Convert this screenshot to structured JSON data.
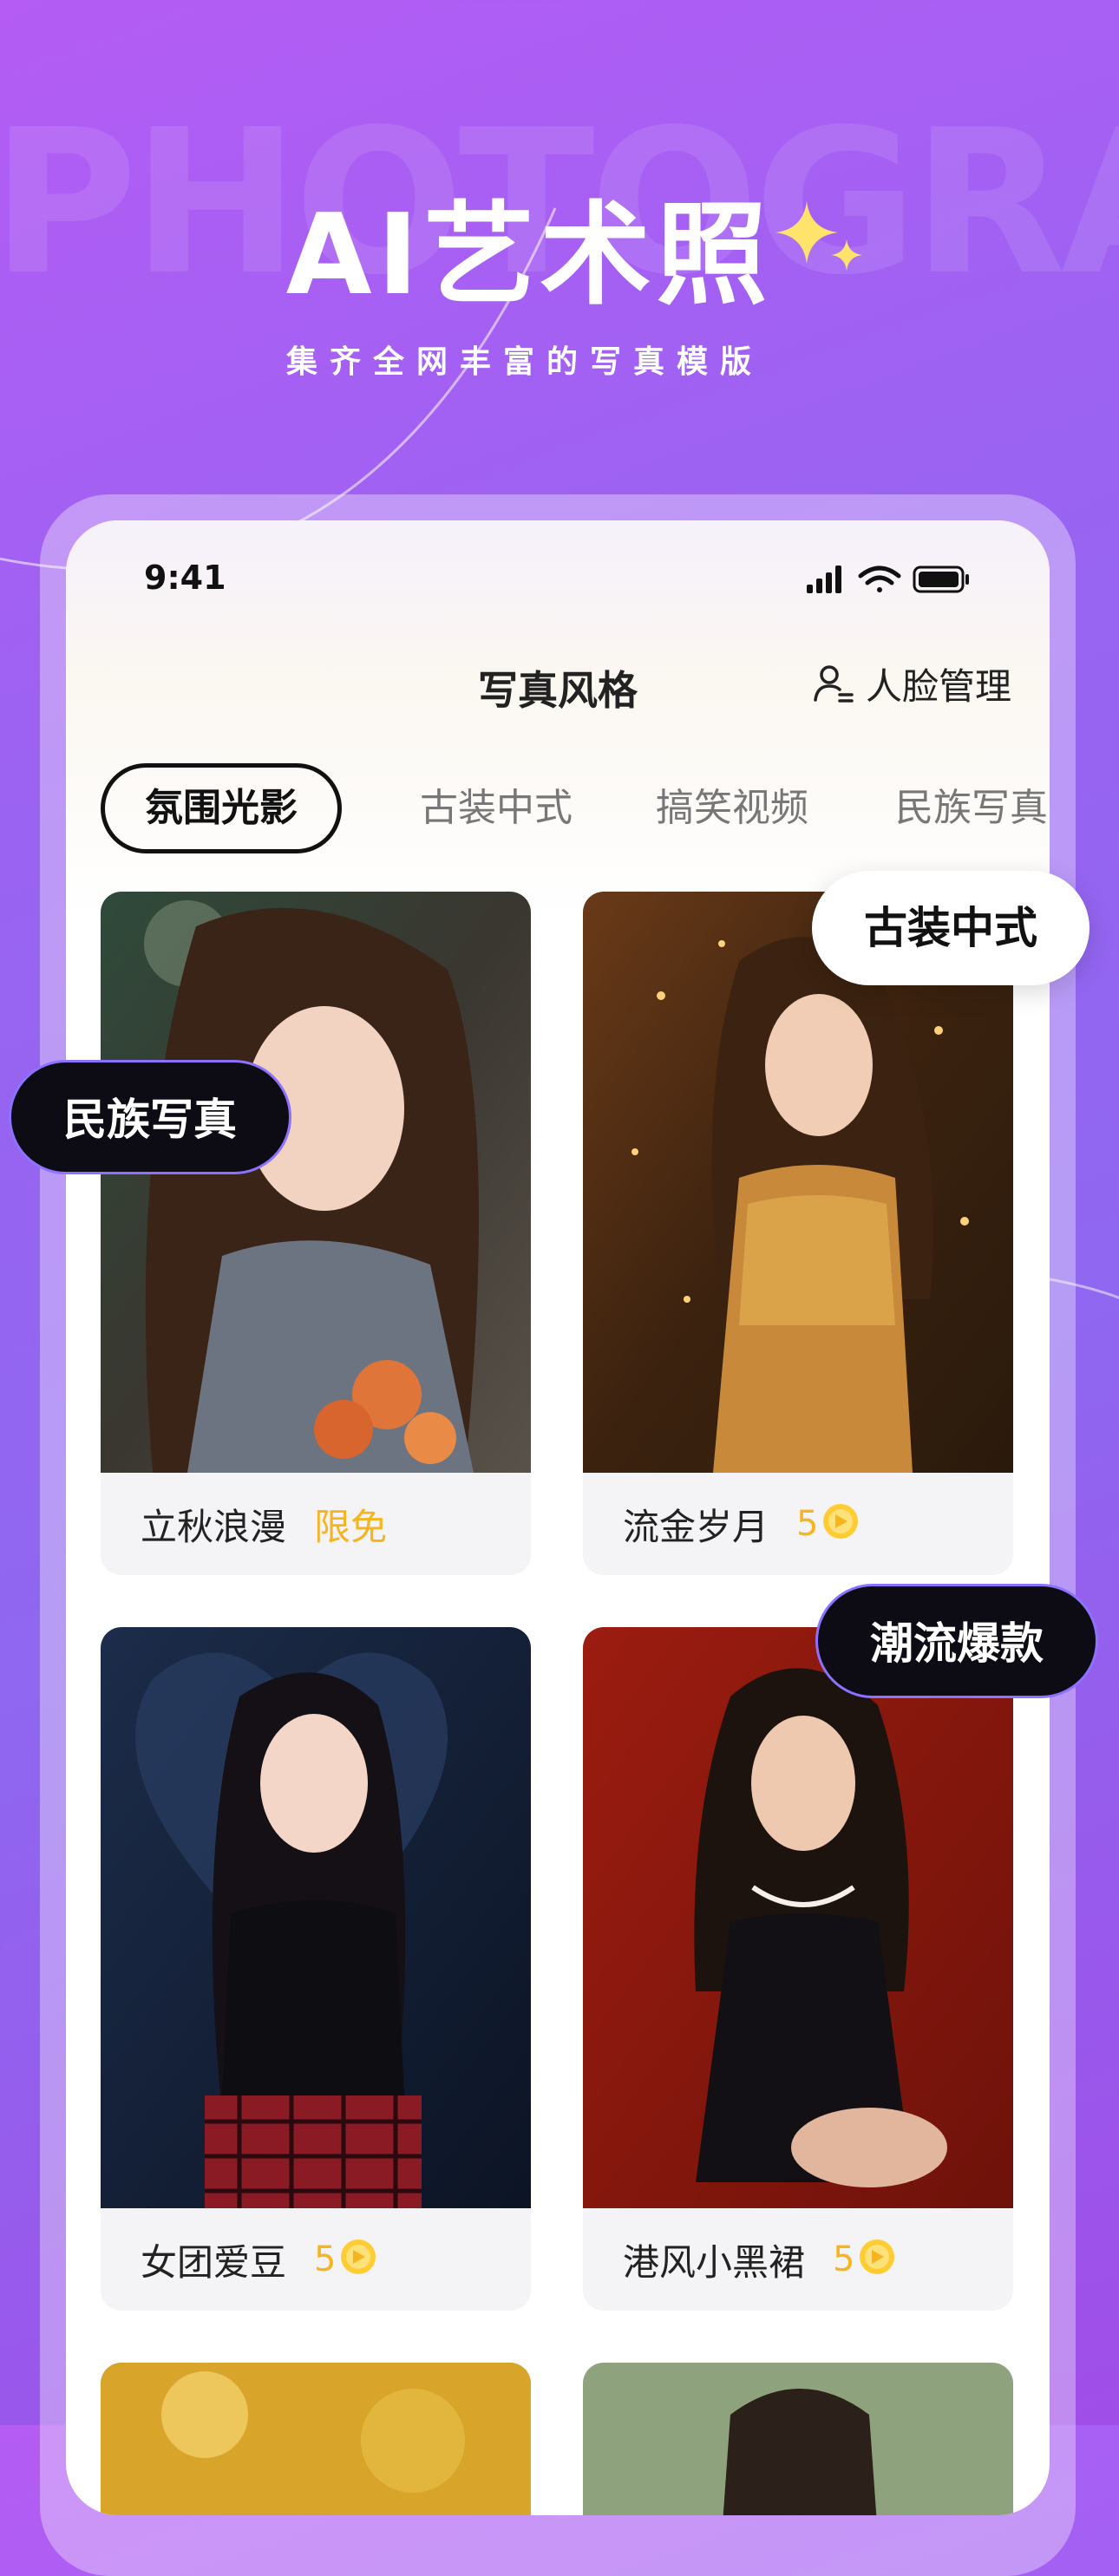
{
  "hero": {
    "bg_word": "PHOTOGRA",
    "title": "AI艺术照",
    "subtitle": "集齐全网丰富的写真模版"
  },
  "status_bar": {
    "time": "9:41"
  },
  "nav": {
    "title": "写真风格",
    "face_management": "人脸管理"
  },
  "tabs": [
    "氛围光影",
    "古装中式",
    "搞笑视频",
    "民族写真"
  ],
  "cards": [
    {
      "name": "立秋浪漫",
      "tag": "限免"
    },
    {
      "name": "流金岁月",
      "price": "5"
    },
    {
      "name": "女团爱豆",
      "price": "5"
    },
    {
      "name": "港风小黑裙",
      "price": "5"
    }
  ],
  "floating_tags": {
    "ethnic": "民族写真",
    "ancient": "古装中式",
    "trending": "潮流爆款"
  },
  "colors": {
    "accent_yellow": "#f6b51f",
    "bg_purple": "#9a63f2",
    "pill_dark": "#0d0b14"
  }
}
